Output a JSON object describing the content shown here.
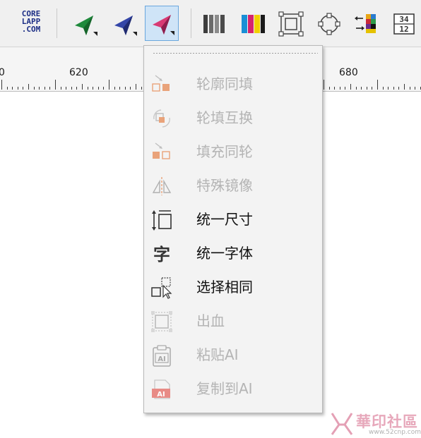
{
  "toolbar": {
    "logo_text": "CORE\nLAPP\n.COM",
    "buttons": [
      {
        "name": "green-plane-tool-button",
        "icon": "paper-plane-icon",
        "color": "#1f8a3c"
      },
      {
        "name": "blue-plane-tool-button",
        "icon": "paper-plane-icon",
        "color": "#2a3a96"
      },
      {
        "name": "pink-plane-tool-button",
        "icon": "paper-plane-icon",
        "color": "#d2336e",
        "active": true
      },
      {
        "name": "gray-bars-button",
        "icon": "gray-bars-icon"
      },
      {
        "name": "color-bars-button",
        "icon": "color-bars-icon"
      },
      {
        "name": "frame-align-button",
        "icon": "frame-align-icon"
      },
      {
        "name": "circle-nodes-button",
        "icon": "circle-nodes-icon"
      },
      {
        "name": "arrow-swatch-button",
        "icon": "arrow-swatch-icon"
      },
      {
        "name": "number-grid-button",
        "icon": "number-grid-icon",
        "text_top": "34",
        "text_bottom": "12"
      }
    ]
  },
  "ruler": {
    "labels": [
      "0",
      "620",
      "680"
    ]
  },
  "menu": {
    "items": [
      {
        "label": "轮廓同填",
        "icon": "outline-to-fill-icon",
        "enabled": false
      },
      {
        "label": "轮填互换",
        "icon": "swap-fill-outline-icon",
        "enabled": false
      },
      {
        "label": "填充同轮",
        "icon": "fill-to-outline-icon",
        "enabled": false
      },
      {
        "label": "特殊镜像",
        "icon": "mirror-icon",
        "enabled": false
      },
      {
        "label": "统一尺寸",
        "icon": "uniform-size-icon",
        "enabled": true
      },
      {
        "label": "统一字体",
        "icon": "uniform-font-icon",
        "enabled": true,
        "glyph": "字"
      },
      {
        "label": "选择相同",
        "icon": "select-same-icon",
        "enabled": true
      },
      {
        "label": "出血",
        "icon": "bleed-icon",
        "enabled": false
      },
      {
        "label": "粘贴AI",
        "icon": "paste-ai-icon",
        "enabled": false,
        "badge": "AI"
      },
      {
        "label": "复制到AI",
        "icon": "copy-to-ai-icon",
        "enabled": false,
        "badge": "AI"
      }
    ]
  },
  "watermark": {
    "text": "華印社區",
    "url": "www.52cnp.com"
  }
}
